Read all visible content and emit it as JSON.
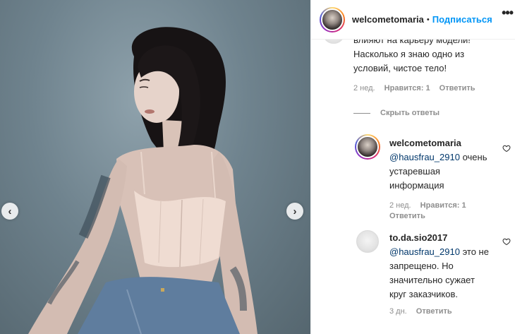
{
  "post": {
    "username": "welcometomaria",
    "follow_label": "Подписаться",
    "dot": "•",
    "more_label": "•••"
  },
  "comments": {
    "first": {
      "text_lines": [
        "влияют на карьеру модели!",
        "Насколько я знаю одно из",
        "условий, чистое тело!"
      ],
      "time": "2 нед.",
      "likes": "Нравится: 1",
      "reply": "Ответить"
    },
    "hide_replies": "Скрыть ответы",
    "reply1": {
      "username": "welcometomaria",
      "mention": "@hausfrau_2910",
      "first_line_rest": "очень",
      "lines": [
        "устаревшая",
        "информация"
      ],
      "time": "2 нед.",
      "likes": "Нравится: 1",
      "reply": "Ответить"
    },
    "reply2": {
      "username": "to.da.sio2017",
      "mention": "@hausfrau_2910",
      "first_line_rest": "это не",
      "lines": [
        "запрещено. Но",
        "значительно сужает",
        "круг заказчиков."
      ],
      "time": "3 дн.",
      "reply": "Ответить"
    }
  },
  "icons": {
    "prev": "‹",
    "next": "›"
  },
  "colors": {
    "accent": "#0095f6",
    "mention": "#00376b",
    "muted": "#8e8e8e",
    "photo_bg": "#6f838e"
  }
}
